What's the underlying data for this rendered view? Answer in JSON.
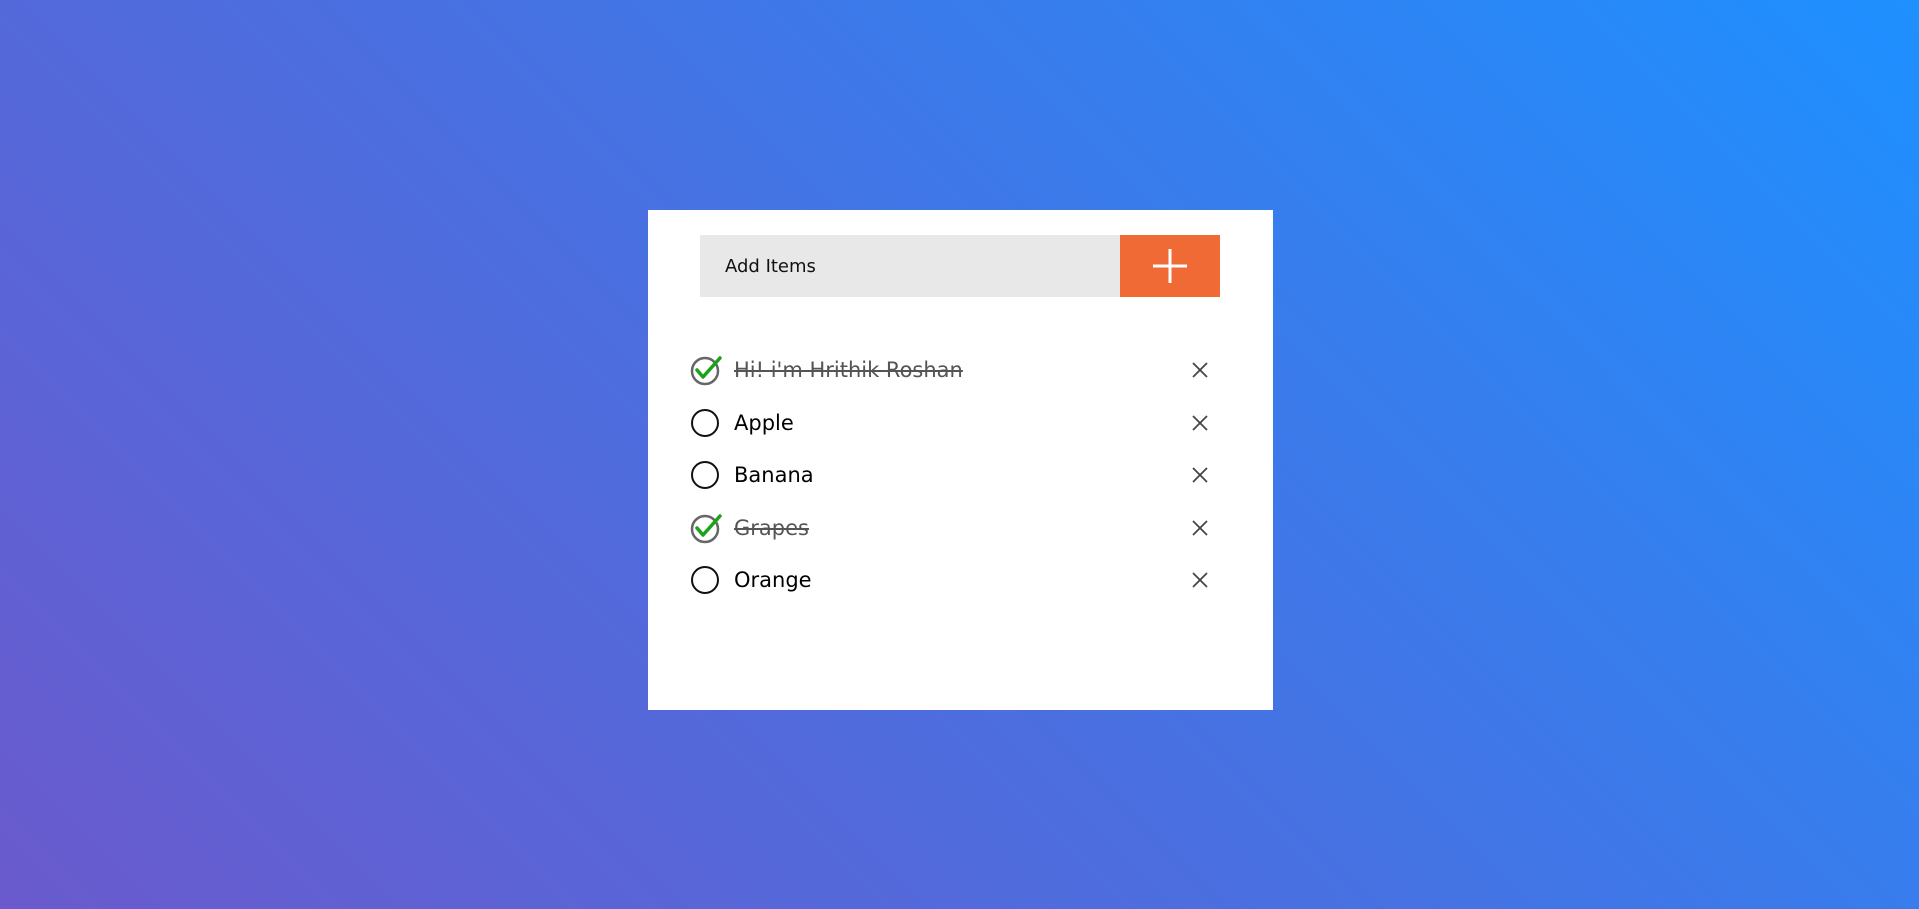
{
  "todo": {
    "input": {
      "placeholder": "Add Items",
      "value": ""
    },
    "add_button_icon": "plus-icon",
    "items": [
      {
        "label": "Hi! i'm Hrithik Roshan",
        "done": true
      },
      {
        "label": "Apple",
        "done": false
      },
      {
        "label": "Banana",
        "done": false
      },
      {
        "label": "Grapes",
        "done": true
      },
      {
        "label": "Orange",
        "done": false
      }
    ]
  },
  "colors": {
    "accent": "#f06a35",
    "check_green": "#1aa31a",
    "input_bg": "#e8e8e8",
    "gradient_start": "#6a5acd",
    "gradient_end": "#1e90ff"
  }
}
